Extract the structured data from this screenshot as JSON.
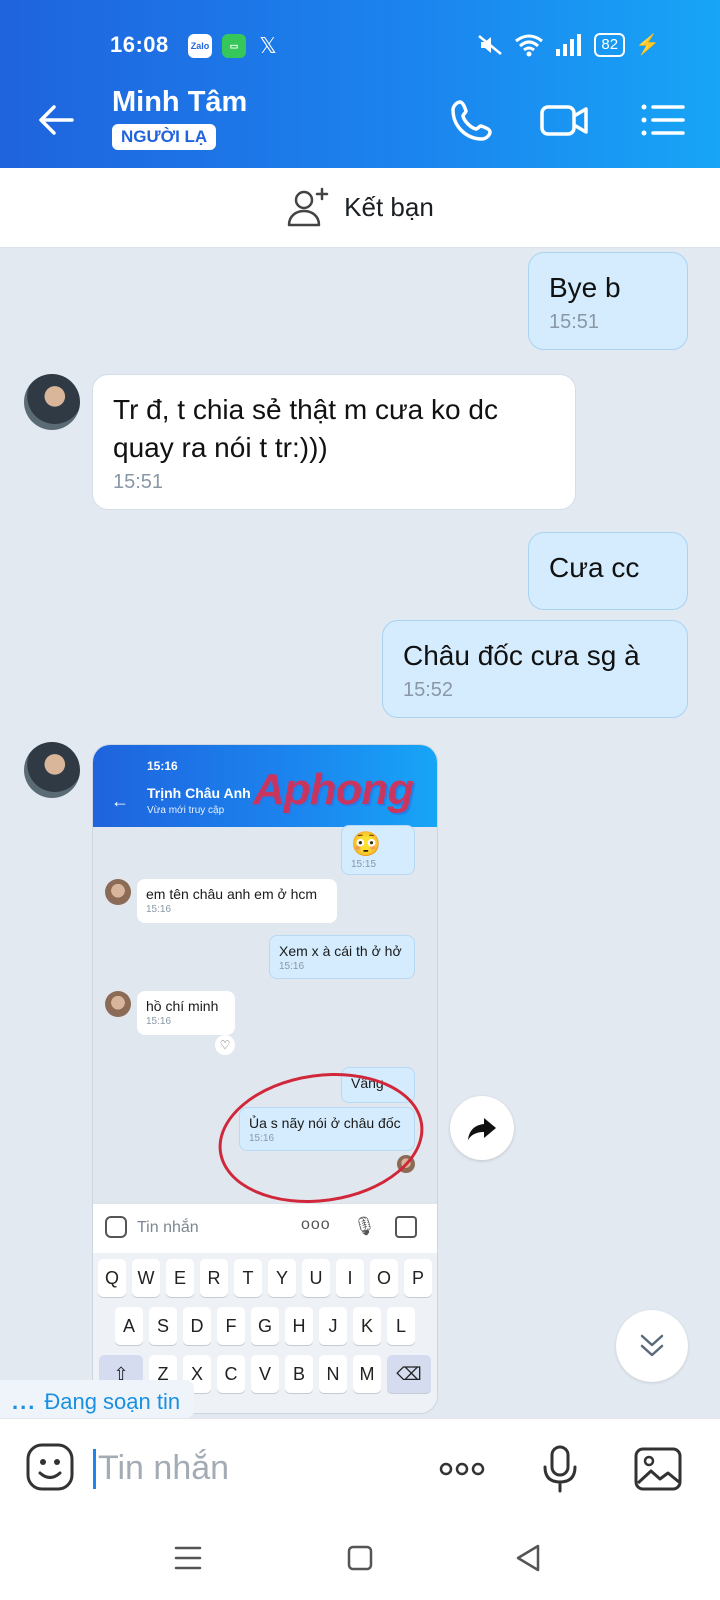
{
  "status_bar": {
    "time": "16:08",
    "app_icons": [
      "Zalo",
      "messages-icon",
      "x-icon"
    ],
    "battery": "82"
  },
  "header": {
    "contact_name": "Minh Tâm",
    "badge": "NGƯỜI LẠ",
    "icons": [
      "back-arrow-icon",
      "phone-icon",
      "video-call-icon",
      "menu-list-icon"
    ]
  },
  "add_friend": {
    "label": "Kết bạn"
  },
  "messages": [
    {
      "side": "me",
      "text": "Bye b",
      "time": "15:51"
    },
    {
      "side": "them",
      "text": "Tr đ, t chia sẻ thật m cưa ko dc quay ra nói t tr:)))",
      "time": "15:51"
    },
    {
      "side": "me",
      "text": "Cưa cc",
      "time": ""
    },
    {
      "side": "me",
      "text": "Châu đốc cưa sg à",
      "time": "15:52"
    }
  ],
  "shared_image": {
    "status_time": "15:16",
    "contact_name": "Trịnh Châu Anh",
    "contact_status": "Vừa mới truy cập",
    "watermark": "Aphong",
    "chat": [
      {
        "side": "me",
        "text": "😳",
        "time": "15:15"
      },
      {
        "side": "them",
        "text": "em tên châu anh em ở hcm",
        "time": "15:16"
      },
      {
        "side": "me",
        "text": "Xem x à cái th ở hở",
        "time": "15:16"
      },
      {
        "side": "them",
        "text": "hồ chí minh",
        "time": "15:16"
      },
      {
        "side": "me",
        "text": "Vâng",
        "time": ""
      },
      {
        "side": "me",
        "text": "Ủa s nãy nói ở châu đốc",
        "time": "15:16"
      }
    ],
    "input_placeholder": "Tin nhắn",
    "keyboard_rows": [
      [
        "Q",
        "W",
        "E",
        "R",
        "T",
        "Y",
        "U",
        "I",
        "O",
        "P"
      ],
      [
        "A",
        "S",
        "D",
        "F",
        "G",
        "H",
        "J",
        "K",
        "L"
      ],
      [
        "⇧",
        "Z",
        "X",
        "C",
        "V",
        "B",
        "N",
        "M",
        "⌫"
      ]
    ]
  },
  "typing_indicator": {
    "dots": "...",
    "text": "Đang soạn tin"
  },
  "composer": {
    "placeholder": "Tin nhắn",
    "icons": [
      "emoji-icon",
      "more-icon",
      "mic-icon",
      "image-icon"
    ]
  },
  "nav_bar": {
    "icons": [
      "recent-apps-icon",
      "home-icon",
      "back-icon"
    ]
  },
  "colors": {
    "header_start": "#1f63dd",
    "header_end": "#17a5f6",
    "bubble_me": "#d4ecfd",
    "bubble_them": "#ffffff",
    "background": "#e2e9f1"
  }
}
